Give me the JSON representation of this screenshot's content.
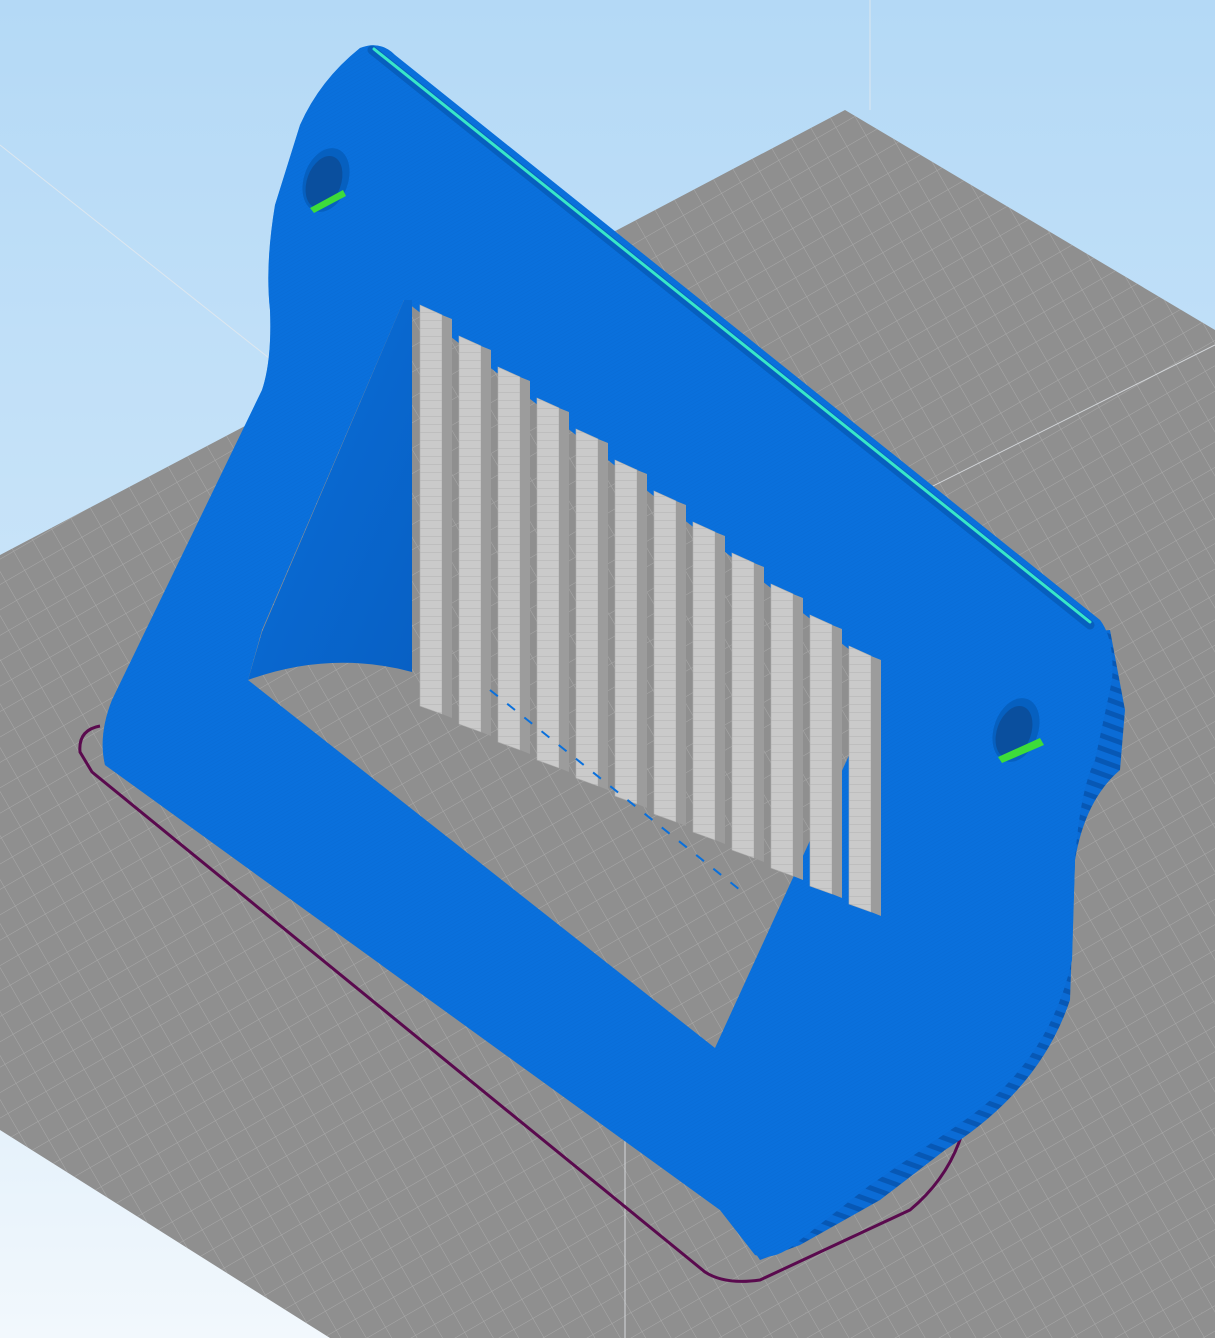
{
  "app": {
    "view": "slicer-preview"
  },
  "scene": {
    "object": "printed-stand",
    "colors": {
      "background_top": "#b4d9f6",
      "background_bottom": "#eef6fd",
      "bed": "#8f8f8f",
      "bed_grid": "#a9a9a9",
      "perimeter": "#0a70dc",
      "perimeter_shade": "#075fbe",
      "support": "#c9c9c9",
      "top_solid_infill": "#38e6c8",
      "bridge_infill": "#3ddc3a",
      "skirt": "#5a0a4e",
      "guide_line": "#e6eaee"
    },
    "features": [
      "skirt",
      "perimeter",
      "support",
      "top-solid-infill",
      "mounting-hole-left",
      "mounting-hole-right"
    ]
  }
}
